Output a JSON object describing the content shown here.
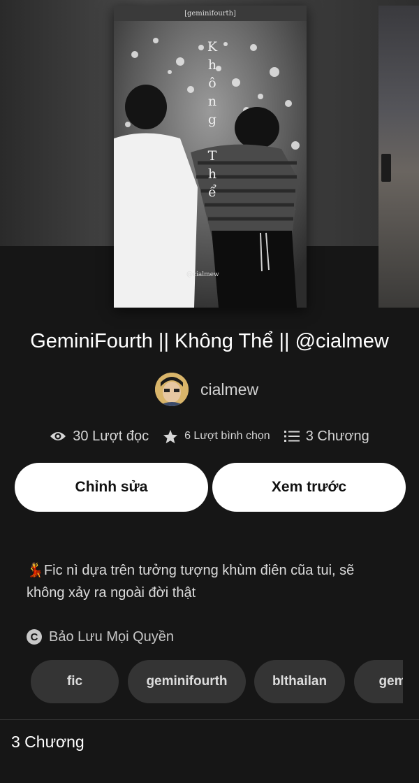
{
  "cover": {
    "tag_text": "[geminifourth]",
    "vertical_title": [
      "K",
      "h",
      "ô",
      "n",
      "g",
      " ",
      "T",
      "h",
      "ể"
    ],
    "credit": "@cialmew"
  },
  "story": {
    "title": "GeminiFourth || Không Thể || @cialmew",
    "author": "cialmew"
  },
  "stats": {
    "reads": "30 Lượt đọc",
    "votes": "6 Lượt bình chọn",
    "chapters": "3 Chương"
  },
  "actions": {
    "edit_label": "Chỉnh sửa",
    "preview_label": "Xem trước"
  },
  "description": {
    "emoji": "💃",
    "text": "Fic nì dựa trên tưởng tượng khùm điên cũa tui, sẽ không xảy ra ngoài đời thật"
  },
  "copyright": {
    "icon": "copyright-icon",
    "text": "Bảo Lưu Mọi Quyền"
  },
  "tags": [
    "fic",
    "geminifourth",
    "blthailan",
    "gem"
  ],
  "chapter_section": {
    "label": "3 Chương"
  },
  "icons": [
    "eye-icon",
    "star-icon",
    "list-icon",
    "copyright-icon"
  ],
  "colors": {
    "background": "#161616",
    "button_bg": "#ffffff",
    "tag_bg": "#343434",
    "text_muted": "#d2d2d2"
  }
}
